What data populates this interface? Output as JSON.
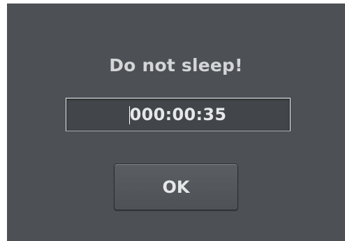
{
  "dialog": {
    "title": "Do not sleep!",
    "timer_value": "000:00:35",
    "ok_label": "OK"
  },
  "colors": {
    "dialog_background": "#4d5156",
    "text": "#e6e7e8",
    "field_border": "#e6e6e6"
  }
}
